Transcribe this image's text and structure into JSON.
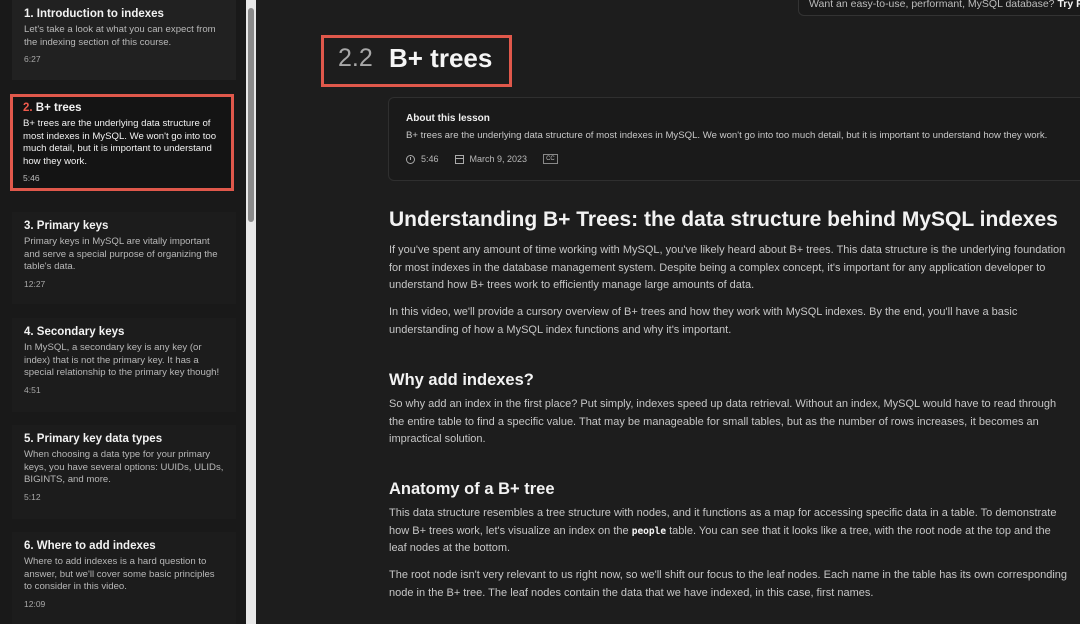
{
  "sidebar": {
    "lessons": [
      {
        "num": "1.",
        "title": "Introduction to indexes",
        "desc": "Let's take a look at what you can expect from the indexing section of this course.",
        "duration": "6:27"
      },
      {
        "num": "2.",
        "title": "B+ trees",
        "desc": "B+ trees are the underlying data structure of most indexes in MySQL. We won't go into too much detail, but it is important to understand how they work.",
        "duration": "5:46"
      },
      {
        "num": "3.",
        "title": "Primary keys",
        "desc": "Primary keys in MySQL are vitally important and serve a special purpose of organizing the table's data.",
        "duration": "12:27"
      },
      {
        "num": "4.",
        "title": "Secondary keys",
        "desc": "In MySQL, a secondary key is any key (or index) that is not the primary key. It has a special relationship to the primary key though!",
        "duration": "4:51"
      },
      {
        "num": "5.",
        "title": "Primary key data types",
        "desc": "When choosing a data type for your primary keys, you have several options: UUIDs, ULIDs, BIGINTS, and more.",
        "duration": "5:12"
      },
      {
        "num": "6.",
        "title": "Where to add indexes",
        "desc": "Where to add indexes is a hard question to answer, but we'll cover some basic principles to consider in this video.",
        "duration": "12:09"
      }
    ]
  },
  "promo": {
    "text": "Want an easy-to-use, performant, MySQL database?",
    "cta": "Try Planet"
  },
  "lesson": {
    "number": "2.2",
    "title": "B+ trees",
    "about_heading": "About this lesson",
    "about_desc": "B+ trees are the underlying data structure of most indexes in MySQL. We won't go into too much detail, but it is important to understand how they work.",
    "duration": "5:46",
    "date": "March 9, 2023",
    "cc": "CC"
  },
  "article": {
    "h2": "Understanding B+ Trees: the data structure behind MySQL indexes",
    "p1": "If you've spent any amount of time working with MySQL, you've likely heard about B+ trees. This data structure is the underlying foundation for most indexes in the database management system. Despite being a complex concept, it's important for any application developer to understand how B+ trees work to efficiently manage large amounts of data.",
    "p2": "In this video, we'll provide a cursory overview of B+ trees and how they work with MySQL indexes. By the end, you'll have a basic understanding of how a MySQL index functions and why it's important.",
    "h3a": "Why add indexes?",
    "p3": "So why add an index in the first place? Put simply, indexes speed up data retrieval. Without an index, MySQL would have to read through the entire table to find a specific value. That may be manageable for small tables, but as the number of rows increases, it becomes an impractical solution.",
    "h3b": "Anatomy of a B+ tree",
    "p4a": "This data structure resembles a tree structure with nodes, and it functions as a map for accessing specific data in a table. To demonstrate how B+ trees work, let's visualize an index on the",
    "p4code": "people",
    "p4b": "table. You can see that it looks like a tree, with the root node at the top and the leaf nodes at the bottom.",
    "p5": "The root node isn't very relevant to us right now, so we'll shift our focus to the leaf nodes. Each name in the table has its own corresponding node in the B+ tree. The leaf nodes contain the data that we have indexed, in this case, first names."
  },
  "colors": {
    "accent": "#e0584b",
    "background": "#1d1d1d"
  }
}
